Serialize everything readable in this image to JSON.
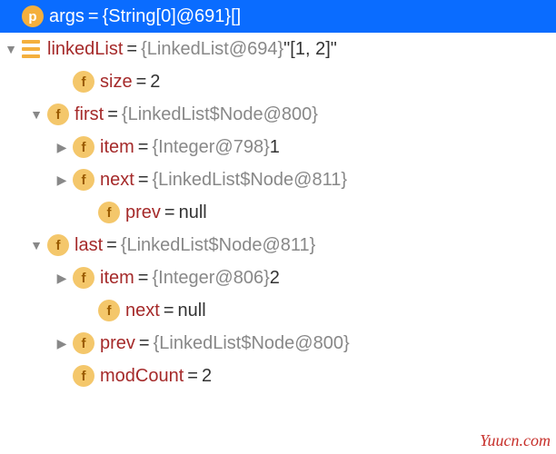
{
  "rows": [
    {
      "indent": 0,
      "arrow": "",
      "badge": "p",
      "name": "args",
      "grey": "{String[0]@691} ",
      "dark": "[]",
      "selected": true
    },
    {
      "indent": 0,
      "arrow": "down",
      "badge": "list",
      "name": "linkedList",
      "grey": "{LinkedList@694} ",
      "dark": "\"[1, 2]\""
    },
    {
      "indent": 2,
      "arrow": "",
      "badge": "f",
      "name": "size",
      "grey": "",
      "dark": "2"
    },
    {
      "indent": 1,
      "arrow": "down",
      "badge": "f",
      "name": "first",
      "grey": "{LinkedList$Node@800}",
      "dark": ""
    },
    {
      "indent": 2,
      "arrow": "right",
      "badge": "f",
      "name": "item",
      "grey": "{Integer@798} ",
      "dark": "1"
    },
    {
      "indent": 2,
      "arrow": "right",
      "badge": "f",
      "name": "next",
      "grey": "{LinkedList$Node@811}",
      "dark": ""
    },
    {
      "indent": 3,
      "arrow": "",
      "badge": "f",
      "name": "prev",
      "grey": "",
      "dark": "null"
    },
    {
      "indent": 1,
      "arrow": "down",
      "badge": "f",
      "name": "last",
      "grey": "{LinkedList$Node@811}",
      "dark": ""
    },
    {
      "indent": 2,
      "arrow": "right",
      "badge": "f",
      "name": "item",
      "grey": "{Integer@806} ",
      "dark": "2"
    },
    {
      "indent": 3,
      "arrow": "",
      "badge": "f",
      "name": "next",
      "grey": "",
      "dark": "null"
    },
    {
      "indent": 2,
      "arrow": "right",
      "badge": "f",
      "name": "prev",
      "grey": "{LinkedList$Node@800}",
      "dark": ""
    },
    {
      "indent": 2,
      "arrow": "",
      "badge": "f",
      "name": "modCount",
      "grey": "",
      "dark": "2"
    }
  ],
  "watermark": "Yuucn.com"
}
